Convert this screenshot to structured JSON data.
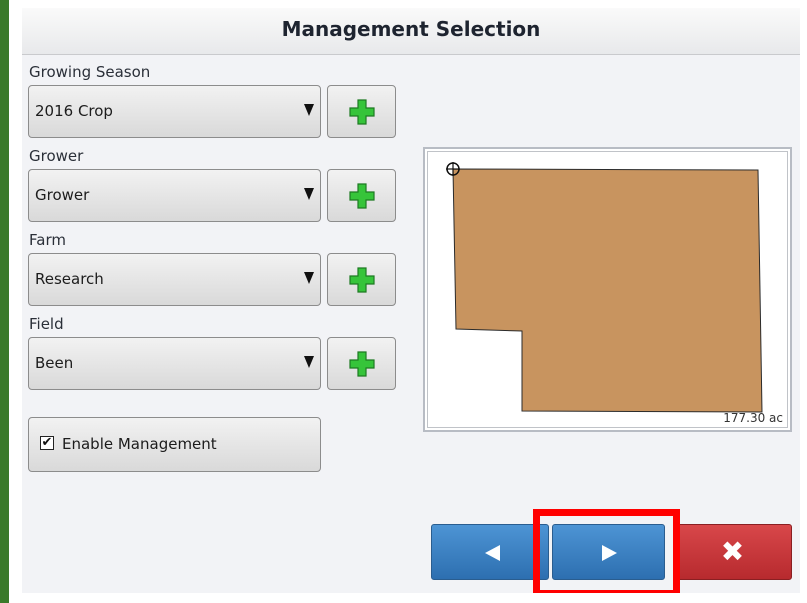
{
  "title": "Management Selection",
  "growing_season": {
    "label": "Growing Season",
    "value": "2016 Crop"
  },
  "grower": {
    "label": "Grower",
    "value": "Grower"
  },
  "farm": {
    "label": "Farm",
    "value": "Research"
  },
  "field": {
    "label": "Field",
    "value": "Been"
  },
  "enable_management": {
    "label": "Enable Management",
    "checked": true,
    "check_glyph": "✔"
  },
  "map": {
    "area": "177.30 ac"
  },
  "nav": {
    "back_icon": "left-arrow-icon",
    "next_icon": "right-arrow-icon",
    "cancel_glyph": "✖"
  },
  "colors": {
    "field_fill": "#c8945f",
    "nav_blue": "#3a7fc1",
    "cancel_red": "#c23236",
    "highlight": "#ff0000",
    "add_green": "#36c43a"
  }
}
